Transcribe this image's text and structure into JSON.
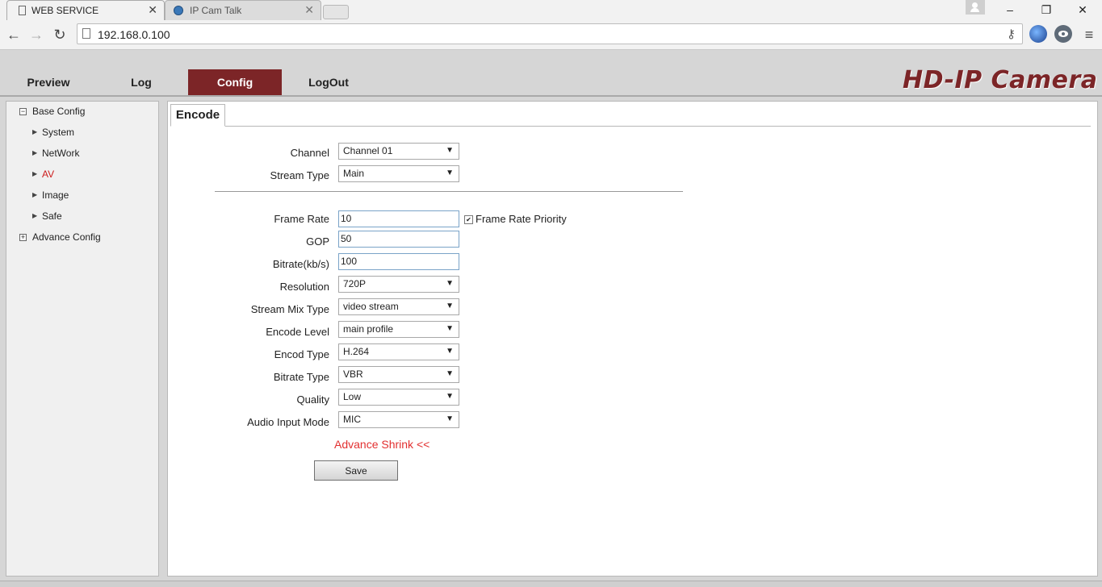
{
  "browser": {
    "tabs": [
      {
        "title": "WEB SERVICE",
        "active": true
      },
      {
        "title": "IP Cam Talk",
        "active": false
      }
    ],
    "url": "192.168.0.100"
  },
  "header": {
    "menu": [
      "Preview",
      "Log",
      "Config",
      "LogOut"
    ],
    "active_menu": "Config",
    "brand": "HD-IP Camera",
    "accent_color": "#7c2527"
  },
  "sidebar": {
    "base_config": "Base Config",
    "items": [
      "System",
      "NetWork",
      "AV",
      "Image",
      "Safe"
    ],
    "active_item": "AV",
    "advance_config": "Advance Config"
  },
  "panel": {
    "tab": "Encode",
    "fields": {
      "channel": {
        "label": "Channel",
        "value": "Channel 01"
      },
      "stream_type": {
        "label": "Stream Type",
        "value": "Main"
      },
      "frame_rate": {
        "label": "Frame Rate",
        "value": "10"
      },
      "frame_rate_priority": {
        "label": "Frame Rate Priority",
        "checked": true
      },
      "gop": {
        "label": "GOP",
        "value": "50"
      },
      "bitrate": {
        "label": "Bitrate(kb/s)",
        "value": "100"
      },
      "resolution": {
        "label": "Resolution",
        "value": "720P"
      },
      "stream_mix_type": {
        "label": "Stream Mix Type",
        "value": "video stream"
      },
      "encode_level": {
        "label": "Encode Level",
        "value": "main profile"
      },
      "encod_type": {
        "label": "Encod Type",
        "value": "H.264"
      },
      "bitrate_type": {
        "label": "Bitrate Type",
        "value": "VBR"
      },
      "quality": {
        "label": "Quality",
        "value": "Low"
      },
      "audio_input_mode": {
        "label": "Audio Input Mode",
        "value": "MIC"
      }
    },
    "advance_toggle": "Advance Shrink <<",
    "save_label": "Save"
  }
}
